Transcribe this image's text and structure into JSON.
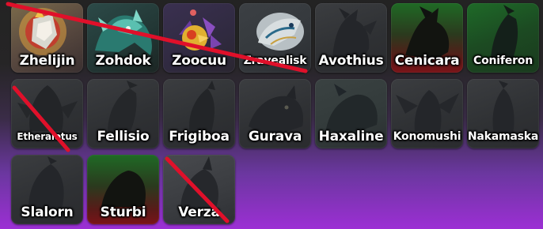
{
  "colors": {
    "strike": "#e0102a",
    "tile_green": "#1f6a25",
    "tile_red": "#7a1418",
    "bg_top": "#232323",
    "bg_bottom": "#9c2fd4"
  },
  "creatures": [
    {
      "name": "Zhelijin",
      "crossed": true,
      "icon": "creature-zhelijin-icon"
    },
    {
      "name": "Zohdok",
      "crossed": true,
      "icon": "creature-zohdok-icon"
    },
    {
      "name": "Zoocuu",
      "crossed": true,
      "icon": "creature-zoocuu-icon"
    },
    {
      "name": "Zravealisk",
      "crossed": true,
      "icon": "creature-zravealisk-icon"
    },
    {
      "name": "Avothius",
      "crossed": false,
      "icon": "creature-avothius-silhouette-icon"
    },
    {
      "name": "Cenicara",
      "crossed": false,
      "icon": "creature-cenicara-silhouette-icon"
    },
    {
      "name": "Coniferon",
      "crossed": false,
      "icon": "creature-coniferon-silhouette-icon"
    },
    {
      "name": "Etheralotus",
      "crossed": true,
      "icon": "creature-etheralotus-silhouette-icon"
    },
    {
      "name": "Fellisio",
      "crossed": false,
      "icon": "creature-fellisio-silhouette-icon"
    },
    {
      "name": "Frigiboa",
      "crossed": false,
      "icon": "creature-frigiboa-silhouette-icon"
    },
    {
      "name": "Gurava",
      "crossed": false,
      "icon": "creature-gurava-silhouette-icon"
    },
    {
      "name": "Haxaline",
      "crossed": false,
      "icon": "creature-haxaline-silhouette-icon"
    },
    {
      "name": "Konomushi",
      "crossed": false,
      "icon": "creature-konomushi-silhouette-icon"
    },
    {
      "name": "Nakamaska",
      "crossed": false,
      "icon": "creature-nakamaska-silhouette-icon"
    },
    {
      "name": "Slalorn",
      "crossed": false,
      "icon": "creature-slalorn-silhouette-icon"
    },
    {
      "name": "Sturbi",
      "crossed": false,
      "icon": "creature-sturbi-silhouette-icon"
    },
    {
      "name": "Verza",
      "crossed": true,
      "icon": "creature-verza-silhouette-icon"
    }
  ]
}
